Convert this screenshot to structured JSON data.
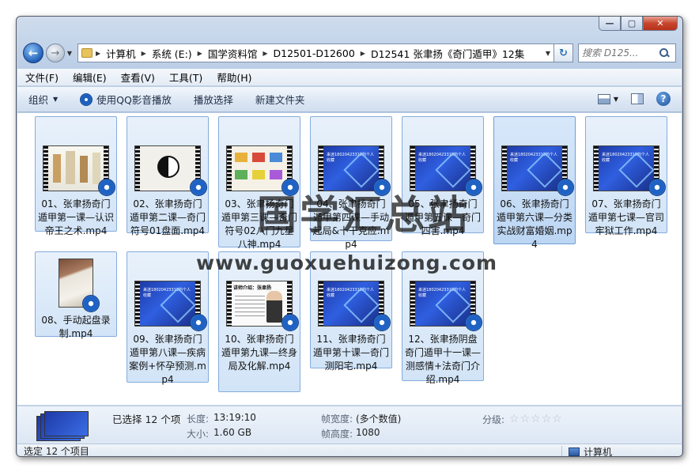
{
  "window": {
    "caption_min": "—",
    "caption_max": "▢",
    "caption_close": "✕"
  },
  "address": {
    "crumbs": [
      "计算机",
      "系统 (E:)",
      "国学资料馆",
      "D12501-D12600",
      "D12541 张聿扬《奇门遁甲》12集"
    ],
    "search_placeholder": "搜索 D125..."
  },
  "menu": [
    "文件(F)",
    "编辑(E)",
    "查看(V)",
    "工具(T)",
    "帮助(H)"
  ],
  "toolbar": {
    "organize": "组织",
    "qq_play": "使用QQ影音播放",
    "play_selection": "播放选择",
    "new_folder": "新建文件夹"
  },
  "files": [
    {
      "name": "01、张聿扬奇门遁甲第一课—认识帝王之术.mp4",
      "thumb": "white"
    },
    {
      "name": "02、张聿扬奇门遁甲第二课—奇门符号01盘面.mp4",
      "thumb": "bagua"
    },
    {
      "name": "03、张聿扬奇门遁甲第三课—奇门符号02八门九星八神.mp4",
      "thumb": "grid"
    },
    {
      "name": "04、张聿扬奇门遁甲第四课—手动起局&十干克应.mp4",
      "thumb": "blue"
    },
    {
      "name": "05、张聿扬奇门遁甲第五课—奇门四害.mp4",
      "thumb": "blue"
    },
    {
      "name": "06、张聿扬奇门遁甲第六课—分类实战财富婚姻.mp4",
      "thumb": "blue"
    },
    {
      "name": "07、张聿扬奇门遁甲第七课—官司牢狱工作.mp4",
      "thumb": "blue"
    },
    {
      "name": "08、手动起盘录制.mp4",
      "thumb": "paper"
    },
    {
      "name": "09、张聿扬奇门遁甲第八课—疾病案例+怀孕预测.mp4",
      "thumb": "blue"
    },
    {
      "name": "10、张聿扬奇门遁甲第九课—终身局及化解.mp4",
      "thumb": "slide"
    },
    {
      "name": "11、张聿扬奇门遁甲第十课—奇门测阳宅.mp4",
      "thumb": "blue"
    },
    {
      "name": "12、张聿扬阴盘奇门遁甲十一课—测感情+法奇门介绍.mp4",
      "thumb": "blue"
    }
  ],
  "thumb_text": {
    "blue_caption": "来迷18020423319的个人\n收藏",
    "slide_header": "讲师介绍：张聿扬"
  },
  "details": {
    "selected": "已选择 12 个项",
    "length_label": "长度:",
    "length_value": "13:19:10",
    "size_label": "大小:",
    "size_value": "1.60 GB",
    "frame_width_label": "帧宽度:",
    "frame_width_value": "(多个数值)",
    "frame_height_label": "帧高度:",
    "frame_height_value": "1080",
    "rating_label": "分级:",
    "rating_stars": 0
  },
  "status": {
    "left": "选定 12 个项目",
    "right": "计算机"
  },
  "watermark": {
    "title": "国学汇总站",
    "url": "www.guoxuehuizong.com"
  }
}
